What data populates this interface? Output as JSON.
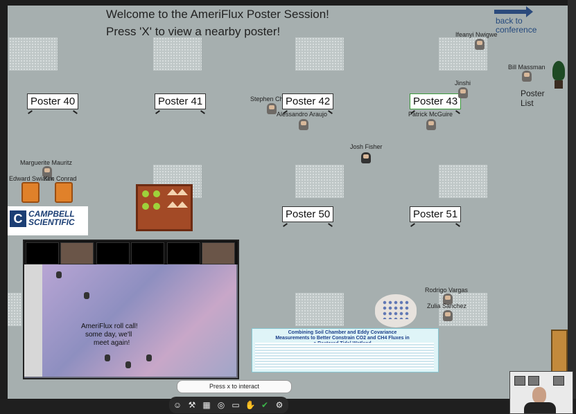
{
  "welcome": {
    "line1": "Welcome to the AmeriFlux Poster Session!",
    "line2": "Press 'X' to view a nearby poster!"
  },
  "nav": {
    "back_label": "back to conference",
    "poster_list": "Poster List"
  },
  "posters": [
    "Poster 40",
    "Poster 41",
    "Poster 42",
    "Poster 43",
    "Poster 50",
    "Poster 51"
  ],
  "people": {
    "ifeanyi": "Ifeanyi Nwigwe",
    "bill": "Bill Massman",
    "jinshi": "Jinshi",
    "stephen": "Stephen Ch",
    "alessandro": "Alessandro Araujo",
    "patrick": "Patrick McGuire",
    "josh": "Josh Fisher",
    "marguerite": "Marguerite Mauritz",
    "edward": "Edward Swiatek",
    "conrad": "Kim Conrad",
    "rodrigo": "Rodrigo Vargas",
    "zulia": "Zulia Sanchez"
  },
  "sponsor": {
    "line1": "CAMPBELL",
    "line2": "SCIENTIFIC"
  },
  "video": {
    "chat1": "AmeriFlux roll call!",
    "chat2": "some day, we'll",
    "chat3": "meet again!"
  },
  "poster_preview": {
    "title": "Combining Soil Chamber and Eddy Covariance Measurements to Better Constrain CO2 and CH4 Fluxes in a Restored Tidal Wetland"
  },
  "interact_hint": "Press x to interact",
  "toolbar_icons": [
    "avatar-icon",
    "hammer-icon",
    "map-icon",
    "target-icon",
    "screen-icon",
    "hand-icon",
    "check-icon",
    "gear-icon"
  ],
  "colors": {
    "floor": "#a6afaf",
    "accent_blue": "#2b4a7c",
    "status_green": "#3bb54a"
  }
}
